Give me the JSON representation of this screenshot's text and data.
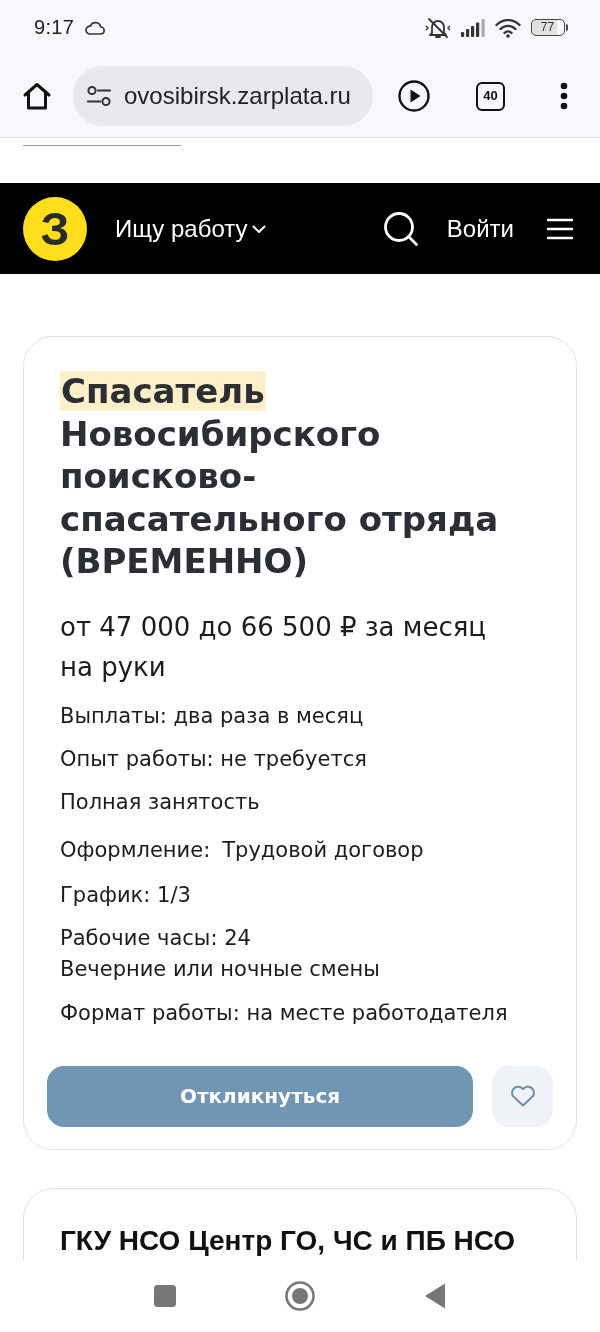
{
  "status_bar": {
    "time": "9:17",
    "battery": "77"
  },
  "browser": {
    "url": "ovosibirsk.zarplata.ru",
    "tab_count": "40"
  },
  "site_header": {
    "logo_letter": "З",
    "nav_menu": "Ищу работу",
    "login": "Войти"
  },
  "vacancy": {
    "title": {
      "highlighted": "Спасатель",
      "text": "Новосибирского поисково-спасательного отряда (ВРЕМЕННО)"
    },
    "salary": "от 47 000 до 66 500 ₽ за месяц",
    "salary_note": "на руки",
    "details": [
      {
        "kind": "text",
        "text": "Выплаты: два раза в месяц"
      },
      {
        "kind": "text",
        "text": "Опыт работы: не требуется"
      },
      {
        "kind": "text",
        "text": "Полная занятость"
      },
      {
        "kind": "field",
        "label": "Оформление:",
        "value": "Трудовой договор"
      },
      {
        "kind": "text",
        "text": "График: 1/3"
      },
      {
        "kind": "lines",
        "lines": [
          "Рабочие часы: 24",
          "Вечерние или ночные смены"
        ]
      },
      {
        "kind": "text",
        "text": "Формат работы: на месте работодателя"
      }
    ],
    "apply_button": "Откликнуться",
    "saved": false
  },
  "employer_card": {
    "name": "ГКУ НСО Центр ГО, ЧС и ПБ НСО"
  }
}
